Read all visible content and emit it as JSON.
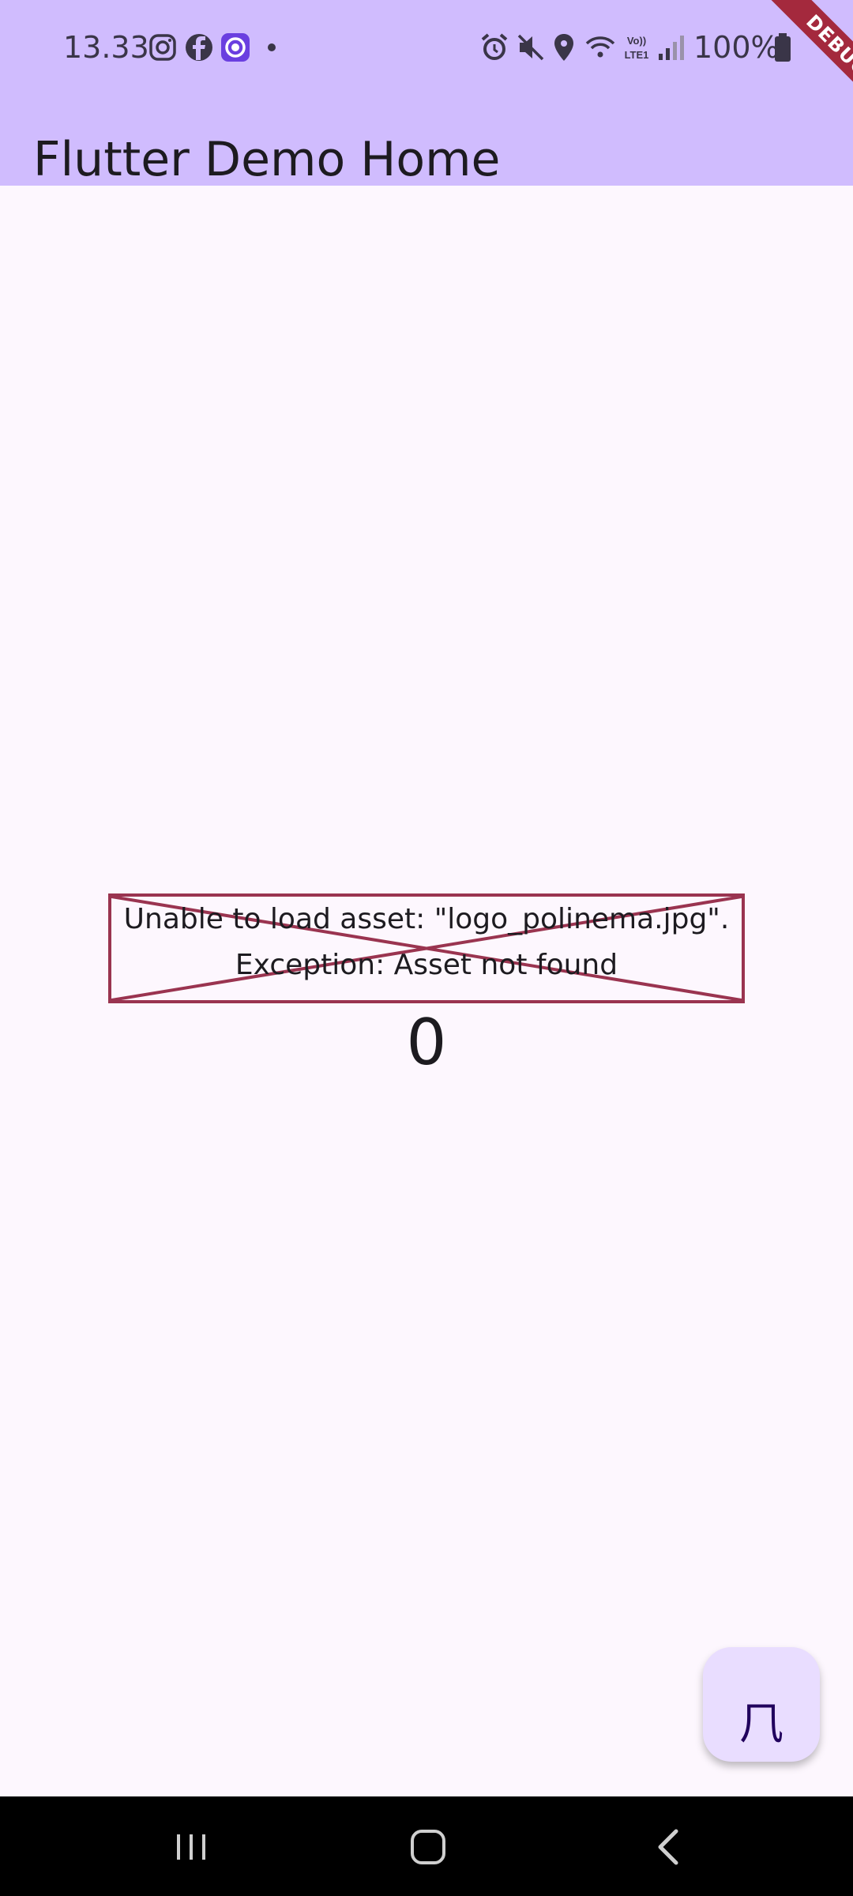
{
  "status_bar": {
    "time": "13.33",
    "battery": "100%",
    "left_icons": [
      "instagram-icon",
      "facebook-icon",
      "messenger-icon",
      "dot-icon"
    ],
    "right_icons": [
      "alarm-icon",
      "mute-icon",
      "location-icon",
      "wifi-icon",
      "volte-icon",
      "signal-icon",
      "battery-icon"
    ],
    "volte_label": "Vo)) LTE1"
  },
  "app_bar": {
    "title": "Flutter Demo Home"
  },
  "debug_banner": {
    "label": "DEBUG"
  },
  "error_image": {
    "line1": "Unable to load asset: \"logo_polinema.jpg\".",
    "line2": "Exception: Asset not found"
  },
  "counter": {
    "value": "0"
  },
  "fab": {
    "icon": "kanji-icon",
    "glyph": "⺇"
  },
  "nav_bar": {
    "buttons": [
      "recent-apps-icon",
      "home-icon",
      "back-icon"
    ]
  },
  "colors": {
    "app_bar_bg": "#d0bcfe",
    "page_bg": "#fdf7fe",
    "error_border": "#9a3450",
    "fab_bg": "#e9ddff",
    "debug_banner": "#a4293d"
  }
}
